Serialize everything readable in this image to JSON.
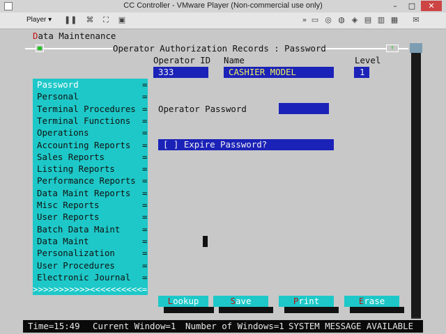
{
  "window": {
    "title": "CC Controller - VMware Player (Non-commercial use only)",
    "minimize": "–",
    "maximize": "□",
    "close": "✕"
  },
  "toolbar": {
    "player_menu": "Player ▾",
    "icons": [
      "pause-icon",
      "send-ctrl-alt-del-icon",
      "fullscreen-icon",
      "devices-icon"
    ]
  },
  "terminal": {
    "menu_title": "Data Maintenance",
    "menu_title_hotkey": "D",
    "menu_title_rest": "ata Maintenance",
    "window_title": "Operator Authorization Records : Password",
    "frame_left": "=[■]=",
    "frame_right": "=[↑]=",
    "labels": {
      "operator_id": "Operator ID",
      "name": "Name",
      "level": "Level",
      "operator_password": "Operator Password"
    },
    "values": {
      "operator_id": "333",
      "name": "CASHIER MODEL",
      "level": "1",
      "password": ""
    },
    "expire_password": "[ ] Expire Password?",
    "menu_items": [
      "Password",
      "Personal",
      "Terminal Procedures",
      "Terminal Functions",
      "Operations",
      "Accounting Reports",
      "Sales Reports",
      "Listing Reports",
      "Performance Reports",
      "Data Maint Reports",
      "Misc Reports",
      "User Reports",
      "Batch Data Maint",
      "Data Maint",
      "Personalization",
      "User Procedures",
      "Electronic Journal"
    ],
    "menu_eq": "=",
    "menu_scroll": ">>>>>>>>>>><<<<<<<<<<=",
    "function_keys": [
      {
        "hotkey": "L",
        "rest": "ookup"
      },
      {
        "hotkey": "S",
        "rest": "ave"
      },
      {
        "hotkey": "P",
        "rest": "rint"
      },
      {
        "hotkey": "E",
        "rest": "rase"
      }
    ],
    "status": {
      "time": "Time=15:49",
      "current_window": "Current Window=1",
      "number_of_windows": "Number of Windows=1",
      "message": "SYSTEM MESSAGE AVAILABLE"
    }
  },
  "colors": {
    "cyan": "#1ec8c8",
    "blue": "#1b22b8",
    "hotkey_red": "#c01010"
  }
}
